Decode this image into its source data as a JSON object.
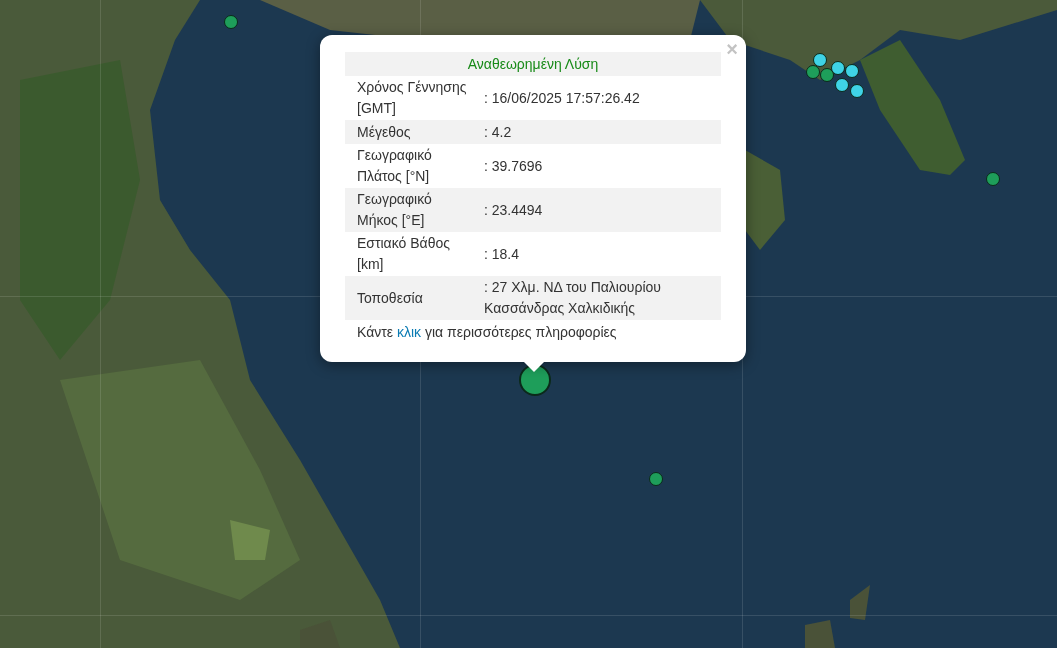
{
  "markers": [
    {
      "color": "#1e9e5a",
      "selected": false
    },
    {
      "color": "#1e9e5a",
      "selected": false
    },
    {
      "color": "#1e9e5a",
      "selected": false
    },
    {
      "color": "#3fd3e6",
      "selected": false
    },
    {
      "color": "#3fd3e6",
      "selected": false
    },
    {
      "color": "#3fd3e6",
      "selected": false
    },
    {
      "color": "#3fd3e6",
      "selected": false
    },
    {
      "color": "#3fd3e6",
      "selected": false
    },
    {
      "color": "#1e9e5a",
      "selected": false
    },
    {
      "color": "#1e9e5a",
      "selected": false
    },
    {
      "color": "#1e9e5a",
      "selected": true
    }
  ],
  "popup": {
    "title": "Αναθεωρημένη Λύση",
    "close": "×",
    "rows": [
      {
        "label": "Χρόνος Γέννησης [GMT]",
        "value": ": 16/06/2025 17:57:26.42"
      },
      {
        "label": "Μέγεθος",
        "value": ": 4.2"
      },
      {
        "label": "Γεωγραφικό Πλάτος [°N]",
        "value": ": 39.7696"
      },
      {
        "label": "Γεωγραφικό Μήκος [°E]",
        "value": ": 23.4494"
      },
      {
        "label": "Εστιακό Βάθος [km]",
        "value": ": 18.4"
      },
      {
        "label": "Τοποθεσία",
        "value": ": 27 Χλμ. ΝΔ του Παλιουρίου Κασσάνδρας Χαλκιδικής"
      }
    ],
    "footer": {
      "before": "Κάντε",
      "link": "κλικ",
      "after": "για περισσότερες πληροφορίες"
    }
  }
}
